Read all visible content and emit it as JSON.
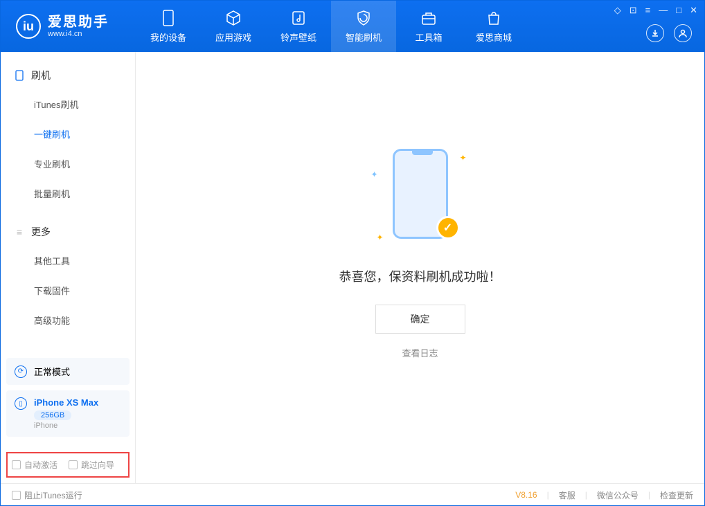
{
  "app": {
    "logo_letter": "iu",
    "title": "爱思助手",
    "subtitle": "www.i4.cn"
  },
  "nav": [
    {
      "label": "我的设备",
      "icon": "device"
    },
    {
      "label": "应用游戏",
      "icon": "cube"
    },
    {
      "label": "铃声壁纸",
      "icon": "music"
    },
    {
      "label": "智能刷机",
      "icon": "shield",
      "active": true
    },
    {
      "label": "工具箱",
      "icon": "toolbox"
    },
    {
      "label": "爱思商城",
      "icon": "bag"
    }
  ],
  "sidebar": {
    "section1": {
      "title": "刷机",
      "items": [
        "iTunes刷机",
        "一键刷机",
        "专业刷机",
        "批量刷机"
      ],
      "active_index": 1
    },
    "section2": {
      "title": "更多",
      "items": [
        "其他工具",
        "下载固件",
        "高级功能"
      ]
    },
    "mode": "正常模式",
    "device": {
      "name": "iPhone XS Max",
      "capacity": "256GB",
      "type": "iPhone"
    },
    "checkboxes": {
      "auto_activate": "自动激活",
      "skip_guide": "跳过向导"
    }
  },
  "main": {
    "success_text": "恭喜您，保资料刷机成功啦！",
    "ok_button": "确定",
    "view_log": "查看日志"
  },
  "footer": {
    "block_itunes": "阻止iTunes运行",
    "version": "V8.16",
    "links": [
      "客服",
      "微信公众号",
      "检查更新"
    ]
  }
}
